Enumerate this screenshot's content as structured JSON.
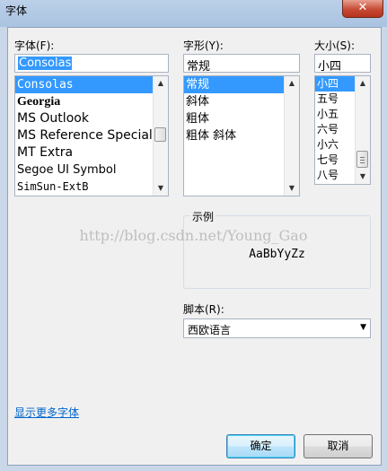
{
  "window": {
    "title": "字体",
    "close_glyph": "✕"
  },
  "font_family": {
    "label": "字体(F):",
    "value": "Consolas",
    "items": [
      "Consolas",
      "Georgia",
      "MS Outlook",
      "MS Reference Specialt",
      "MT Extra",
      "Segoe UI Symbol",
      "SimSun-ExtB"
    ]
  },
  "font_style": {
    "label": "字形(Y):",
    "value": "常规",
    "items": [
      "常规",
      "斜体",
      "粗体",
      "粗体 斜体"
    ]
  },
  "font_size": {
    "label": "大小(S):",
    "value": "小四",
    "items": [
      "小四",
      "五号",
      "小五",
      "六号",
      "小六",
      "七号",
      "八号"
    ]
  },
  "sample": {
    "legend": "示例",
    "text": "AaBbYyZz"
  },
  "script": {
    "label": "脚本(R):",
    "value": "西欧语言"
  },
  "more_fonts_link": "显示更多字体",
  "buttons": {
    "ok": "确定",
    "cancel": "取消"
  },
  "watermark": "http://blog.csdn.net/Young_Gao",
  "icons": {
    "scroll_up": "▲",
    "scroll_down": "▼",
    "dropdown": "▼"
  }
}
